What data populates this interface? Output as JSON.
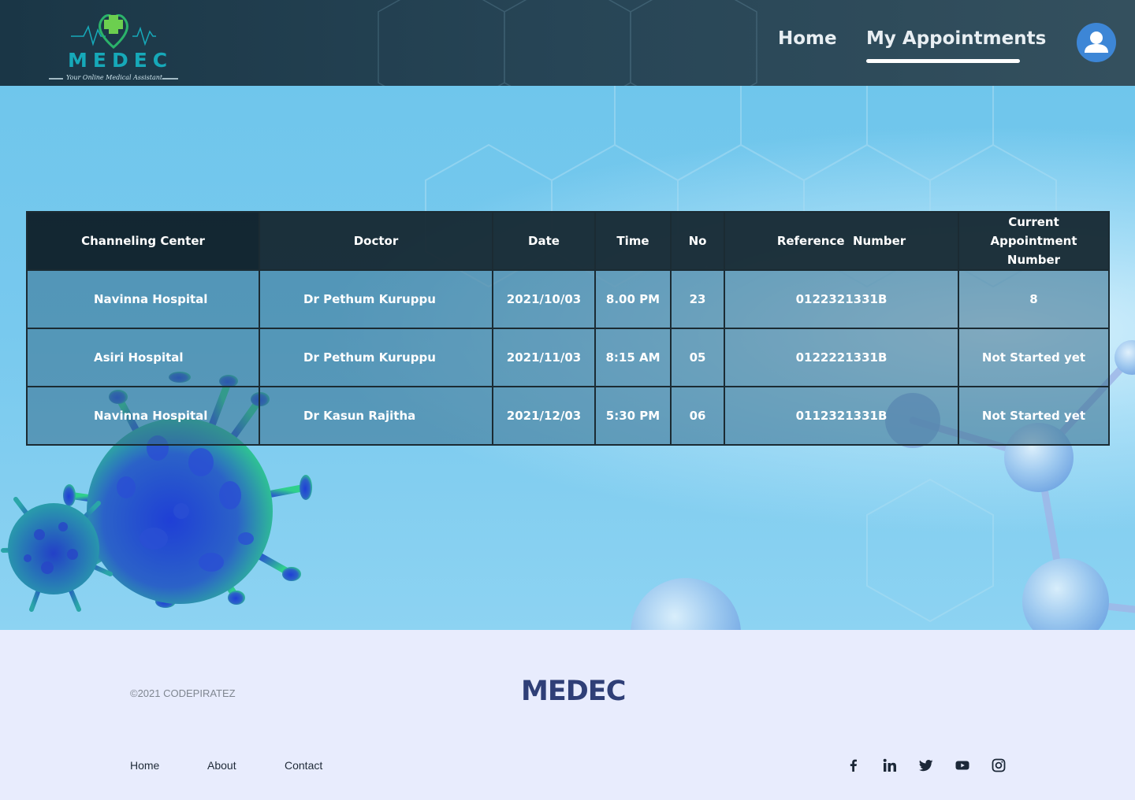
{
  "brand": {
    "logo_text": "MEDEC",
    "tagline": "Your Online Medical Assistant",
    "logo_colors": {
      "accent": "#16a9b9",
      "cross": "#5cc95a"
    }
  },
  "nav": {
    "home": "Home",
    "my_appointments": "My Appointments",
    "active": "my_appointments",
    "profile_icon": "user-avatar-icon"
  },
  "table": {
    "headers": [
      "Channeling Center",
      "Doctor",
      "Date",
      "Time",
      "No",
      "Reference  Number",
      "Current Appointment Number"
    ],
    "rows": [
      [
        "Navinna Hospital",
        "Dr Pethum Kuruppu",
        "2021/10/03",
        "8.00 PM",
        "23",
        "0122321331B",
        "8"
      ],
      [
        "Asiri Hospital",
        "Dr Pethum Kuruppu",
        "2021/11/03",
        "8:15 AM",
        "05",
        "0122221331B",
        "Not Started yet"
      ],
      [
        "Navinna Hospital",
        "Dr Kasun Rajitha",
        "2021/12/03",
        "5:30 PM",
        "06",
        "0112321331B",
        "Not Started yet"
      ]
    ]
  },
  "footer": {
    "copyright": "©2021 CODEPIRATEZ",
    "brand": "MEDEC",
    "links": [
      "Home",
      "About",
      "Contact"
    ],
    "social_icons": [
      "facebook-icon",
      "linkedin-icon",
      "twitter-icon",
      "youtube-icon",
      "instagram-icon"
    ],
    "brand_color": "#2f3f77"
  }
}
